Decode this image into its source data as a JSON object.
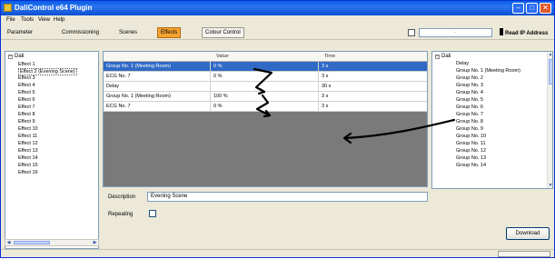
{
  "window": {
    "title": "DaliControl e64 Plugin"
  },
  "menu": [
    "File",
    "Tools",
    "View",
    "Help"
  ],
  "toolbar": {
    "tabs": [
      "Parameter",
      "Commissioning",
      "Scenes",
      "Effects",
      "Colour Control"
    ],
    "active_tab": "Effects",
    "ip_value": "·",
    "read_ip_label": "Read IP Address"
  },
  "left_tree": {
    "root": "Dali",
    "items": [
      "Effect 1",
      "Effect 2 (Evening Scene)",
      "Effect 3",
      "Effect 4",
      "Effect 5",
      "Effect 6",
      "Effect 7",
      "Effect 8",
      "Effect 9",
      "Effect 10",
      "Effect 11",
      "Effect 12",
      "Effect 13",
      "Effect 14",
      "Effect 15",
      "Effect 16"
    ],
    "selected": "Effect 2 (Evening Scene)"
  },
  "table": {
    "columns": [
      "",
      "Value",
      "Time"
    ],
    "rows": [
      {
        "name": "Group No. 1 (Meeting Room)",
        "value": "0 %",
        "time": "3 s"
      },
      {
        "name": "ECG No. 7",
        "value": "0 %",
        "time": "3 s"
      },
      {
        "name": "Delay",
        "value": "",
        "time": "30 s"
      },
      {
        "name": "Group No. 1 (Meeting Room)",
        "value": "100 %",
        "time": "3 s"
      },
      {
        "name": "ECG No. 7",
        "value": "0 %",
        "time": "3 s"
      }
    ]
  },
  "form": {
    "description_label": "Description",
    "description_value": "Evening Scene",
    "repeating_label": "Repeating",
    "repeating_checked": false
  },
  "right_tree": {
    "root": "Dali",
    "items": [
      "Delay",
      "Group No. 1 (Meeting Room)",
      "Group No. 2",
      "Group No. 3",
      "Group No. 4",
      "Group No. 5",
      "Group No. 6",
      "Group No. 7",
      "Group No. 8",
      "Group No. 9",
      "Group No. 10",
      "Group No. 11",
      "Group No. 12",
      "Group No. 13",
      "Group No. 14"
    ]
  },
  "buttons": {
    "download": "Download"
  },
  "colors": {
    "title_bar": "#0a5fe6",
    "active_tab": "#f5a230",
    "selection": "#316ac5",
    "table_bg": "#7a7a7a"
  },
  "icons": [
    "app-icon",
    "minimize-icon",
    "maximize-icon",
    "close-icon",
    "read-ip-icon",
    "tree-collapse-icon",
    "scroll-left-icon",
    "scroll-right-icon",
    "scroll-up-icon",
    "scroll-down-icon",
    "annotation-arrows"
  ]
}
